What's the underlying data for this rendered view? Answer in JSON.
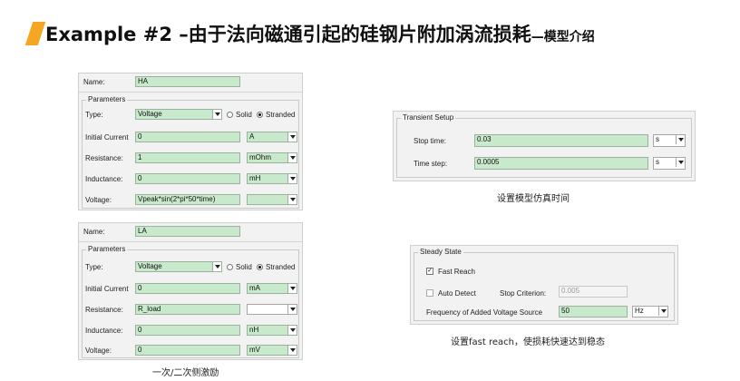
{
  "header": {
    "title_main": "Example #2 –由于法向磁通引起的硅钢片附加涡流损耗",
    "title_tail": "—模型介绍"
  },
  "colors": {
    "accent": "#f5a623",
    "field_fill": "#c9e9cc"
  },
  "panel1": {
    "name_label": "Name:",
    "name_value": "HA",
    "params_label": "Parameters",
    "type_label": "Type:",
    "type_value": "Voltage",
    "solid_label": "Solid",
    "stranded_label": "Stranded",
    "initial_label": "Initial Current",
    "initial_value": "0",
    "initial_unit": "A",
    "resistance_label": "Resistance:",
    "resistance_value": "1",
    "resistance_unit": "mOhm",
    "inductance_label": "Inductance:",
    "inductance_value": "0",
    "inductance_unit": "mH",
    "voltage_label": "Voltage:",
    "voltage_value": "Vpeak*sin(2*pi*50*time)",
    "voltage_unit": ""
  },
  "panel2": {
    "name_label": "Name:",
    "name_value": "LA",
    "params_label": "Parameters",
    "type_label": "Type:",
    "type_value": "Voltage",
    "solid_label": "Solid",
    "stranded_label": "Stranded",
    "initial_label": "Initial Current",
    "initial_value": "0",
    "initial_unit": "mA",
    "resistance_label": "Resistance:",
    "resistance_value": "R_load",
    "resistance_unit": "",
    "inductance_label": "Inductance:",
    "inductance_value": "0",
    "inductance_unit": "nH",
    "voltage_label": "Voltage:",
    "voltage_value": "0",
    "voltage_unit": "mV"
  },
  "caption_left": "一次/二次侧激励",
  "transient": {
    "title": "Transient Setup",
    "stop_label": "Stop time:",
    "stop_value": "0.03",
    "stop_unit": "s",
    "step_label": "Time step:",
    "step_value": "0.0005",
    "step_unit": "s"
  },
  "caption_transient": "设置模型仿真时间",
  "steady": {
    "title": "Steady State",
    "fast_label": "Fast Reach",
    "fast_checked": "✓",
    "auto_label": "Auto Detect",
    "criterion_label": "Stop Criterion:",
    "criterion_value": "0.005",
    "freq_label": "Frequency of Added Voltage Source",
    "freq_value": "50",
    "freq_unit": "Hz"
  },
  "caption_steady": "设置fast reach，使损耗快速达到稳态"
}
